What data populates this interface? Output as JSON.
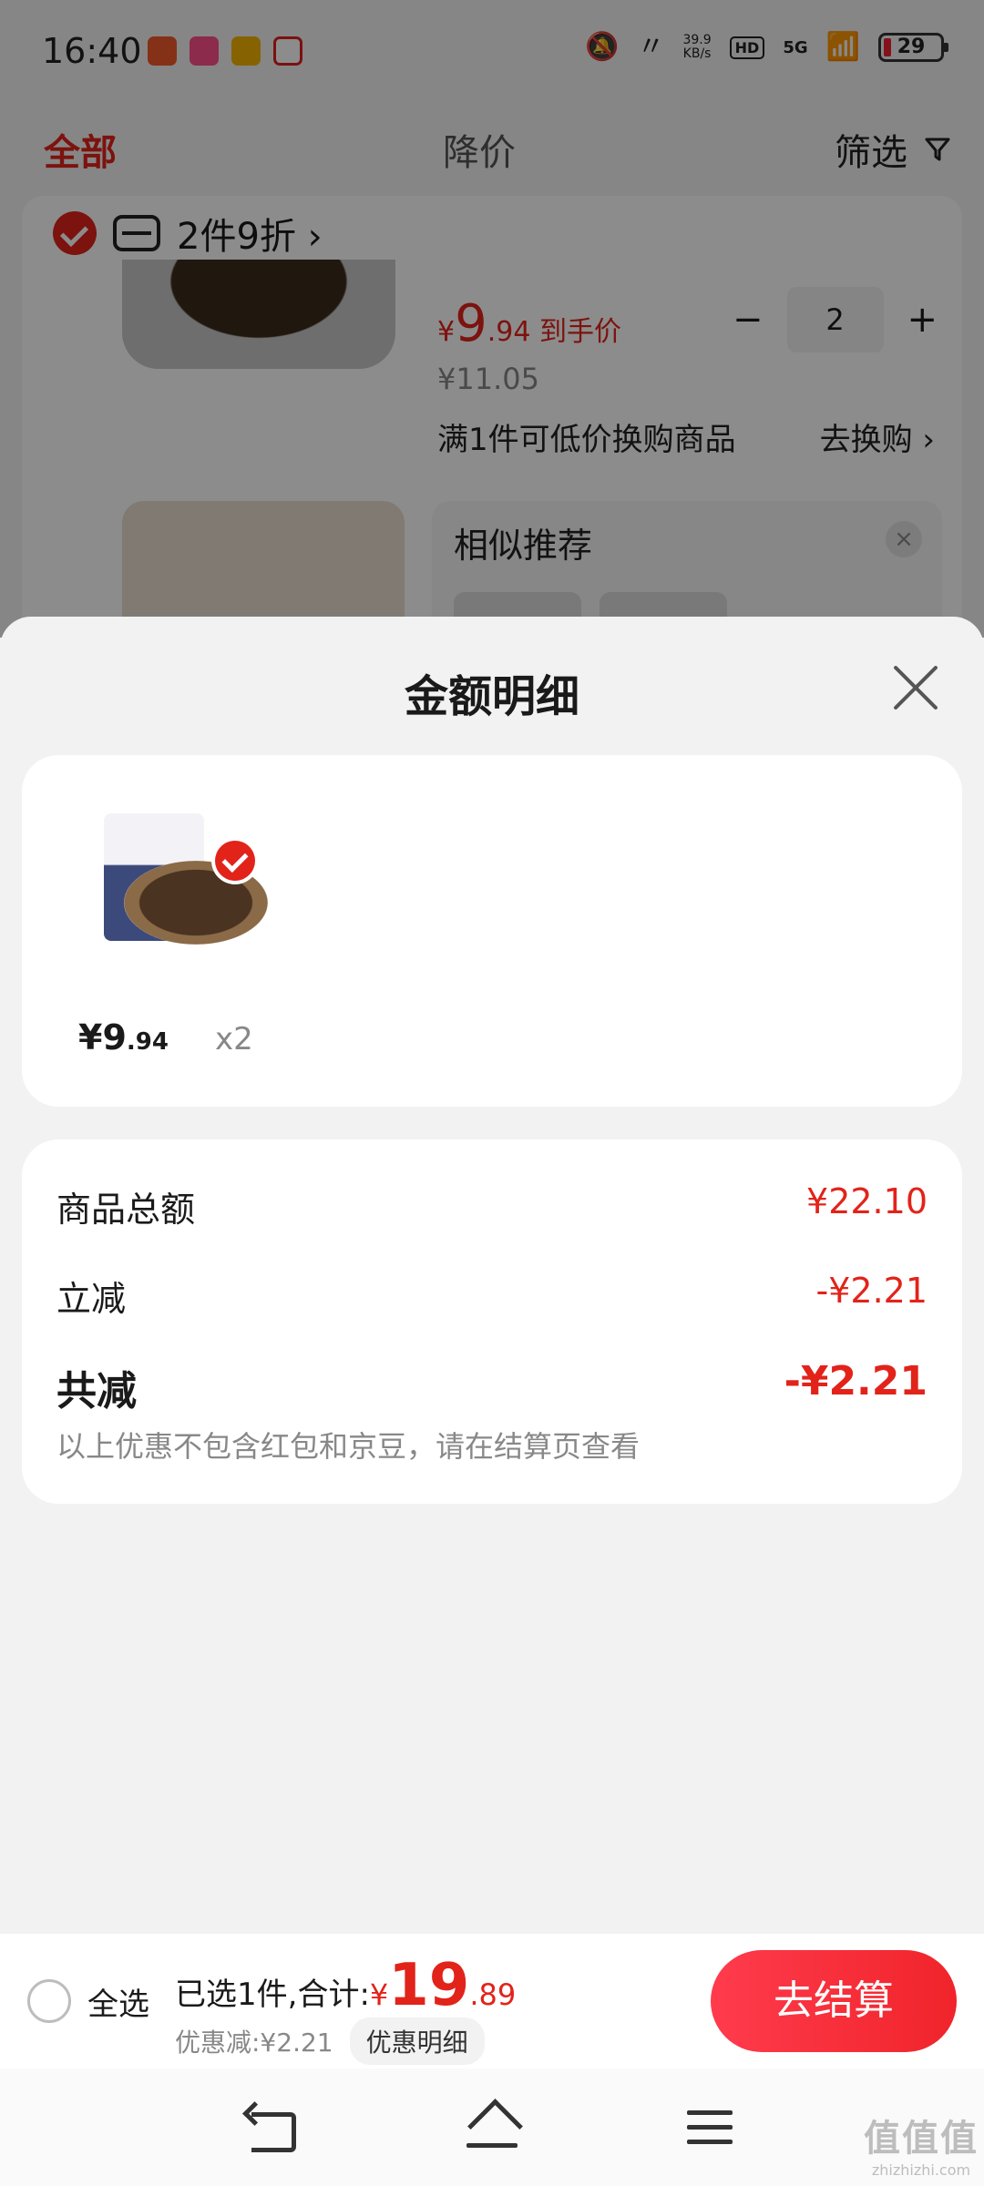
{
  "status_bar": {
    "time": "16:40",
    "net_speed": "39.9\nKB/s",
    "hd": "HD",
    "signal": "5G",
    "battery": "29",
    "app_colors": [
      "#f25a2b",
      "#ff4f8a",
      "#f5b400",
      "#e02020"
    ]
  },
  "tabs": {
    "all": "全部",
    "price_drop": "降价",
    "filter": "筛选"
  },
  "cart_bg": {
    "promo": "2件9折 ›",
    "price_yen": "¥",
    "price_int": "9",
    "price_dec": ".94",
    "price_suffix": " 到手价",
    "minus": "−",
    "qty": "2",
    "plus": "+",
    "original_price": "¥11.05",
    "swap_text": "满1件可低价换购商品",
    "swap_link": "去换购 ›",
    "similar_title": "相似推荐",
    "similar_close": "×"
  },
  "sheet": {
    "title": "金额明细",
    "item": {
      "price_yen": "¥",
      "price_int": "9",
      "price_dec": ".94",
      "qty": "x2"
    },
    "summary": {
      "goods_total_label": "商品总额",
      "goods_total_value": "¥22.10",
      "instant_discount_label": "立减",
      "instant_discount_value": "-¥2.21",
      "total_discount_label": "共减",
      "total_discount_value": "-¥2.21",
      "note": "以上优惠不包含红包和京豆，请在结算页查看"
    }
  },
  "checkout": {
    "select_all": "全选",
    "selected_prefix": "已选1件,合计:",
    "total_yen": "¥",
    "total_int": "19",
    "total_dec": ".89",
    "discount_text": "优惠减:¥2.21",
    "detail_button": "优惠明细",
    "checkout_button": "去结算"
  },
  "watermark": {
    "big": "值值值",
    "small": "zhizhizhi.com"
  },
  "colors": {
    "accent": "#e2231a",
    "button_gradient_start": "#ff3b4d",
    "button_gradient_end": "#f0242a"
  }
}
